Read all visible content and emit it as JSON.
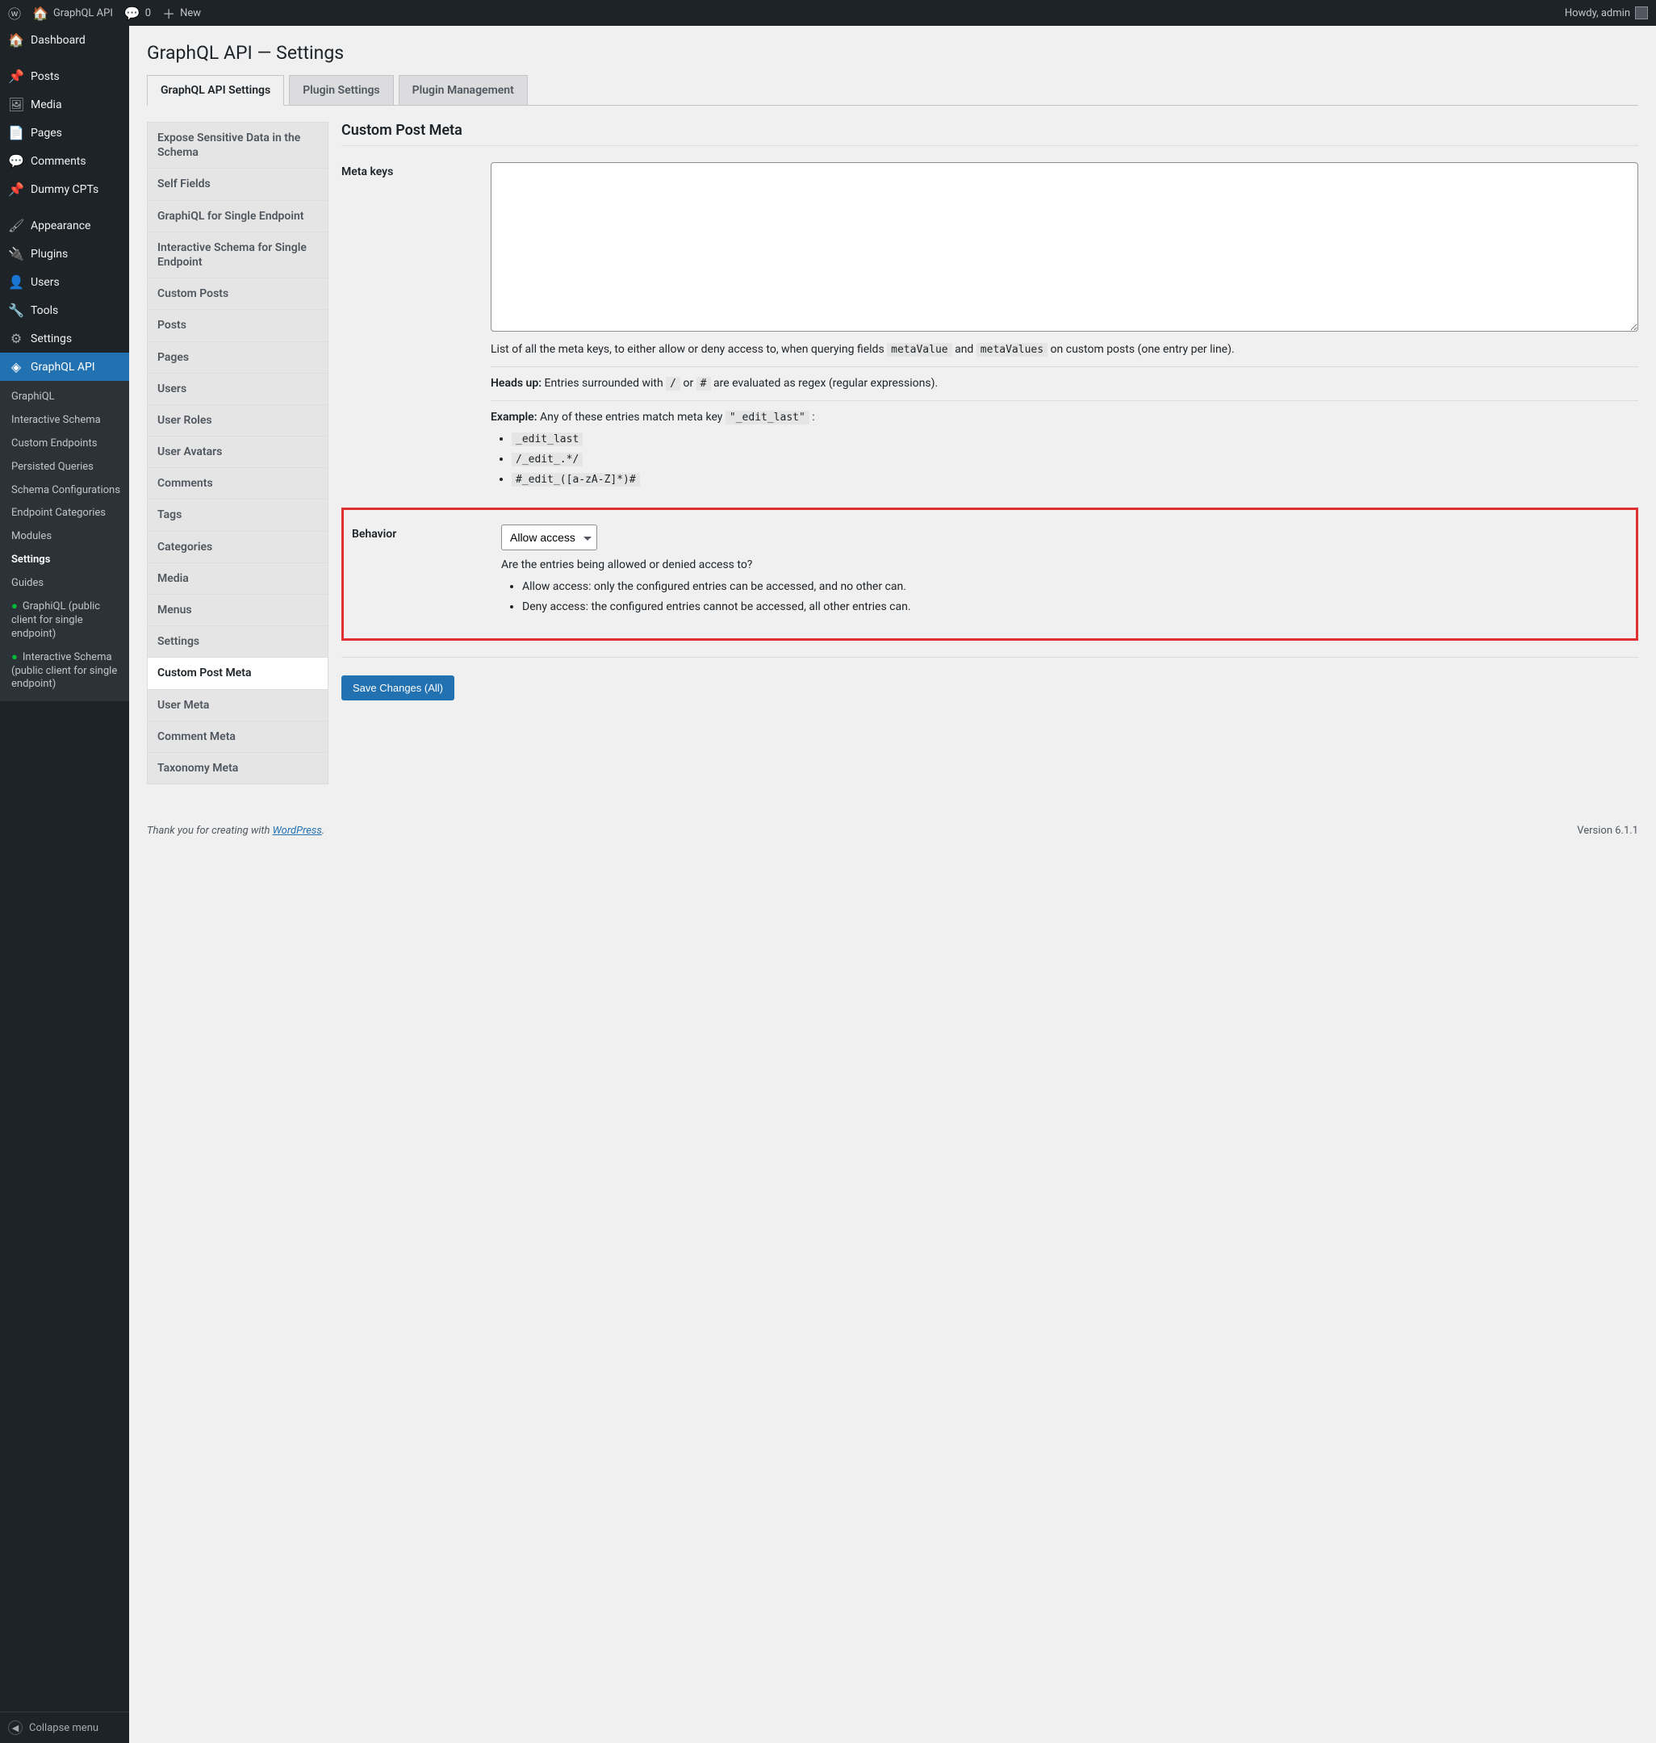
{
  "adminbar": {
    "site": "GraphQL API",
    "comments": "0",
    "new": "New",
    "howdy": "Howdy, admin"
  },
  "sidebar": {
    "items": [
      {
        "label": "Dashboard",
        "icon": "◐"
      },
      {
        "label": "Posts",
        "icon": "✎"
      },
      {
        "label": "Media",
        "icon": "🖾"
      },
      {
        "label": "Pages",
        "icon": "🗐"
      },
      {
        "label": "Comments",
        "icon": "💬"
      },
      {
        "label": "Dummy CPTs",
        "icon": "📌"
      },
      {
        "label": "Appearance",
        "icon": "🖌"
      },
      {
        "label": "Plugins",
        "icon": "🔌"
      },
      {
        "label": "Users",
        "icon": "👤"
      },
      {
        "label": "Tools",
        "icon": "🔧"
      },
      {
        "label": "Settings",
        "icon": "⚙"
      },
      {
        "label": "GraphQL API",
        "icon": "◈"
      }
    ],
    "submenu": [
      "GraphiQL",
      "Interactive Schema",
      "Custom Endpoints",
      "Persisted Queries",
      "Schema Configurations",
      "Endpoint Categories",
      "Modules",
      "Settings",
      "Guides",
      "GraphiQL (public client for single endpoint)",
      "Interactive Schema (public client for single endpoint)"
    ],
    "collapse": "Collapse menu"
  },
  "page": {
    "title": "GraphQL API — Settings",
    "tabs": [
      "GraphQL API Settings",
      "Plugin Settings",
      "Plugin Management"
    ]
  },
  "vtabs": [
    "Expose Sensitive Data in the Schema",
    "Self Fields",
    "GraphiQL for Single Endpoint",
    "Interactive Schema for Single Endpoint",
    "Custom Posts",
    "Posts",
    "Pages",
    "Users",
    "User Roles",
    "User Avatars",
    "Comments",
    "Tags",
    "Categories",
    "Media",
    "Menus",
    "Settings",
    "Custom Post Meta",
    "User Meta",
    "Comment Meta",
    "Taxonomy Meta"
  ],
  "mainSection": {
    "title": "Custom Post Meta",
    "metaKeysLabel": "Meta keys",
    "metaValue": "",
    "desc1a": "List of all the meta keys, to either allow or deny access to, when querying fields ",
    "desc1_code1": "metaValue",
    "desc1_and": " and ",
    "desc1_code2": "metaValues",
    "desc1b": " on custom posts (one entry per line).",
    "headsup_label": "Heads up:",
    "headsup_text1": " Entries surrounded with ",
    "headsup_code1": "/",
    "headsup_or": " or ",
    "headsup_code2": "#",
    "headsup_text2": " are evaluated as regex (regular expressions).",
    "example_label": "Example:",
    "example_text": " Any of these entries match meta key ",
    "example_code": "\"_edit_last\"",
    "example_colon": " :",
    "ex_items": [
      "_edit_last",
      "/_edit_.*/",
      "#_edit_([a-zA-Z]*)#"
    ],
    "behaviorLabel": "Behavior",
    "behaviorSelect": "Allow access",
    "behaviorDesc": "Are the entries being allowed or denied access to?",
    "behaviorBullets": [
      "Allow access: only the configured entries can be accessed, and no other can.",
      "Deny access: the configured entries cannot be accessed, all other entries can."
    ],
    "saveBtn": "Save Changes (All)"
  },
  "footer": {
    "thanks1": "Thank you for creating with ",
    "wp": "WordPress",
    "thanks2": ".",
    "version": "Version 6.1.1"
  }
}
